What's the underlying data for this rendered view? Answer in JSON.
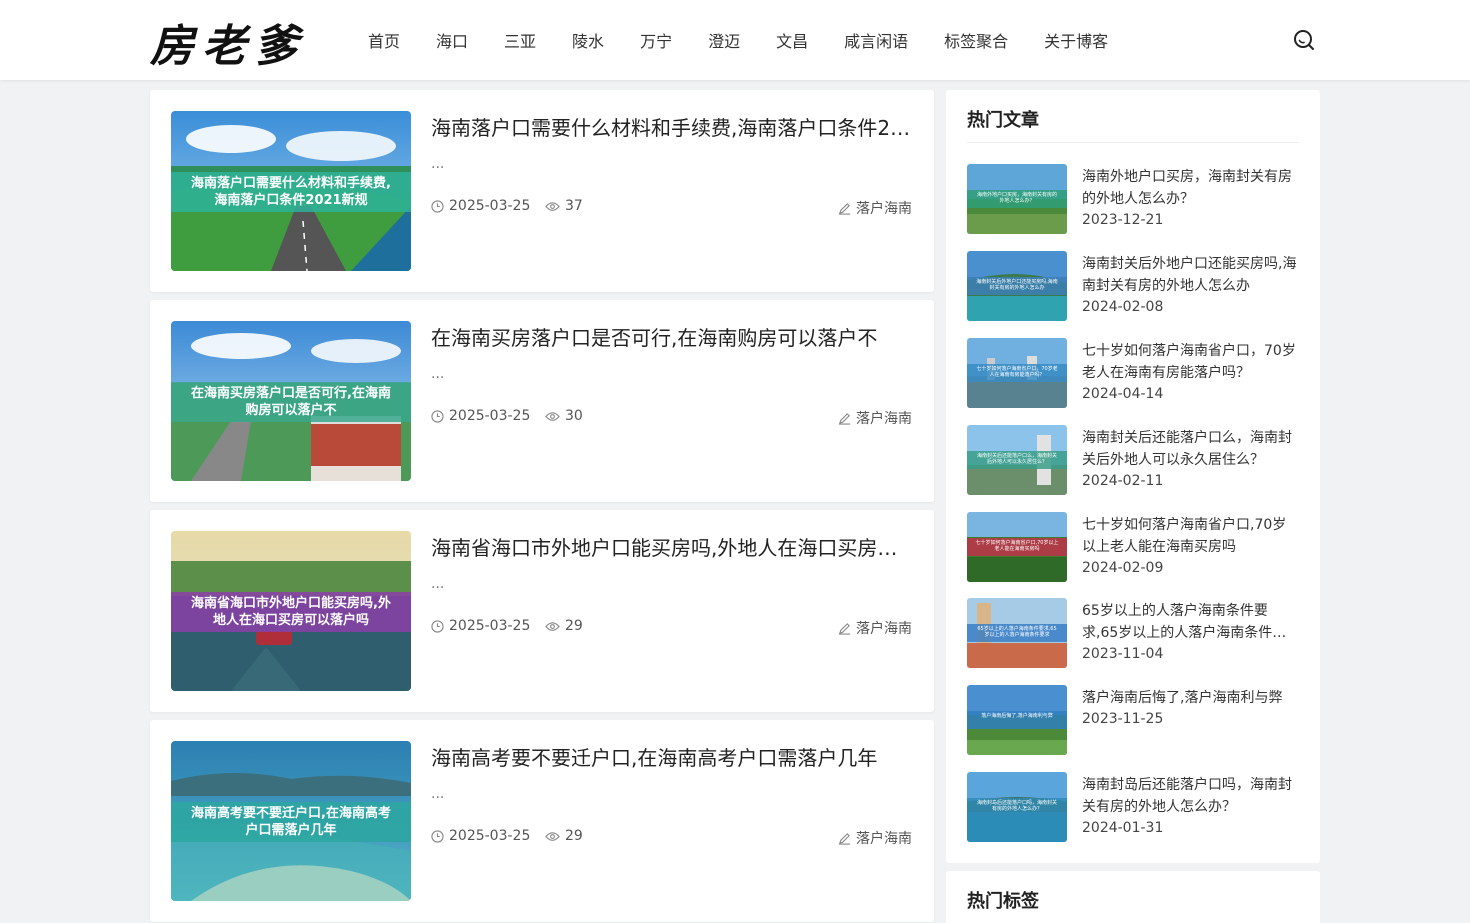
{
  "site": {
    "logo": "房老爹"
  },
  "nav": [
    "首页",
    "海口",
    "三亚",
    "陵水",
    "万宁",
    "澄迈",
    "文昌",
    "咸言闲语",
    "标签聚合",
    "关于博客"
  ],
  "posts": [
    {
      "title": "海南落户口需要什么材料和手续费,海南落户口条件2021新规",
      "excerpt": "...",
      "date": "2025-03-25",
      "views": "37",
      "category": "落户海南",
      "thumb_caption": "海南落户口需要什么材料和手续费,海南落户口条件2021新规",
      "caption_color": "#2eb39a"
    },
    {
      "title": "在海南买房落户口是否可行,在海南购房可以落户不",
      "excerpt": "...",
      "date": "2025-03-25",
      "views": "30",
      "category": "落户海南",
      "thumb_caption": "在海南买房落户口是否可行,在海南购房可以落户不",
      "caption_color": "#3aa88c"
    },
    {
      "title": "海南省海口市外地户口能买房吗,外地人在海口买房可以落户吗",
      "excerpt": "...",
      "date": "2025-03-25",
      "views": "29",
      "category": "落户海南",
      "thumb_caption": "海南省海口市外地户口能买房吗,外地人在海口买房可以落户吗",
      "caption_color": "#8a3fa8"
    },
    {
      "title": "海南高考要不要迁户口,在海南高考户口需落户几年",
      "excerpt": "...",
      "date": "2025-03-25",
      "views": "29",
      "category": "落户海南",
      "thumb_caption": "海南高考要不要迁户口,在海南高考户口需落户几年",
      "caption_color": "#2ca7a0"
    }
  ],
  "sidebar": {
    "hot_title": "热门文章",
    "tags_title": "热门标签",
    "hot": [
      {
        "title": "海南外地户口买房，海南封关有房的外地人怎么办？",
        "date": "2023-12-21",
        "caption": "海南外地户口买房，海南封关有房的外地人怎么办？",
        "caption_color": "#2e9e7a"
      },
      {
        "title": "海南封关后外地户口还能买房吗,海南封关有房的外地人怎么办",
        "date": "2024-02-08",
        "caption": "海南封关后外地户口还能买房吗,海南封关有房的外地人怎么办",
        "caption_color": "#3b7fb8"
      },
      {
        "title": "七十岁如何落户海南省户口，70岁老人在海南有房能落户吗？",
        "date": "2024-04-14",
        "caption": "七十岁如何落户海南省户口，70岁老人在海南有房能落户吗？",
        "caption_color": "#3a8cc4"
      },
      {
        "title": "海南封关后还能落户口么，海南封关后外地人可以永久居住么？",
        "date": "2024-02-11",
        "caption": "海南封关后还能落户口么，海南封关后外地人可以永久居住么？",
        "caption_color": "#3a9e88"
      },
      {
        "title": "七十岁如何落户海南省户口,70岁以上老人能在海南买房吗",
        "date": "2024-02-09",
        "caption": "七十岁如何落户海南省户口,70岁以上老人能在海南买房吗",
        "caption_color": "#c0304a"
      },
      {
        "title": "65岁以上的人落户海南条件要求,65岁以上的人落户海南条件要求",
        "date": "2023-11-04",
        "caption": "65岁以上的人落户海南条件要求,65岁以上的人落户海南条件要求",
        "caption_color": "#3a7fc4"
      },
      {
        "title": "落户海南后悔了,落户海南利与弊",
        "date": "2023-11-25",
        "caption": "落户海南后悔了,落户海南利与弊",
        "caption_color": "#2f7ec0"
      },
      {
        "title": "海南封岛后还能落户口吗，海南封关有房的外地人怎么办？",
        "date": "2024-01-31",
        "caption": "海南封岛后还能落户口吗，海南封关有房的外地人怎么办？",
        "caption_color": "#2f8ab5"
      }
    ]
  },
  "colors": {
    "accent": "#333333",
    "background": "#f1f2f3"
  }
}
